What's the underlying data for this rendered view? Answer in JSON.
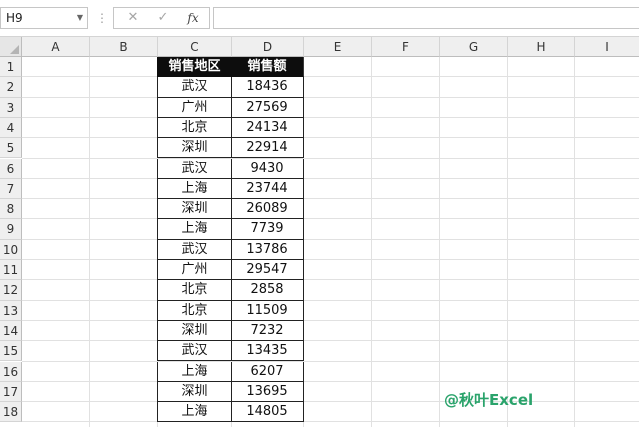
{
  "formula_bar": {
    "name_box": "H9",
    "cancel_icon": "✕",
    "enter_icon": "✓",
    "fx_label": "fx",
    "formula": ""
  },
  "columns": [
    "A",
    "B",
    "C",
    "D",
    "E",
    "F",
    "G",
    "H",
    "I"
  ],
  "rows": [
    "1",
    "2",
    "3",
    "4",
    "5",
    "6",
    "7",
    "8",
    "9",
    "10",
    "11",
    "12",
    "13",
    "14",
    "15",
    "16",
    "17",
    "18"
  ],
  "table": {
    "headers": [
      "销售地区",
      "销售额"
    ],
    "records": [
      [
        "武汉",
        "18436"
      ],
      [
        "广州",
        "27569"
      ],
      [
        "北京",
        "24134"
      ],
      [
        "深圳",
        "22914"
      ],
      [
        "武汉",
        "9430"
      ],
      [
        "上海",
        "23744"
      ],
      [
        "深圳",
        "26089"
      ],
      [
        "上海",
        "7739"
      ],
      [
        "武汉",
        "13786"
      ],
      [
        "广州",
        "29547"
      ],
      [
        "北京",
        "2858"
      ],
      [
        "北京",
        "11509"
      ],
      [
        "深圳",
        "7232"
      ],
      [
        "武汉",
        "13435"
      ],
      [
        "上海",
        "6207"
      ],
      [
        "深圳",
        "13695"
      ],
      [
        "上海",
        "14805"
      ]
    ]
  },
  "watermark": "@秋叶Excel",
  "colors": {
    "header_fill": "#0d0d0d",
    "header_text": "#ffffff",
    "watermark": "#2aa36b"
  }
}
